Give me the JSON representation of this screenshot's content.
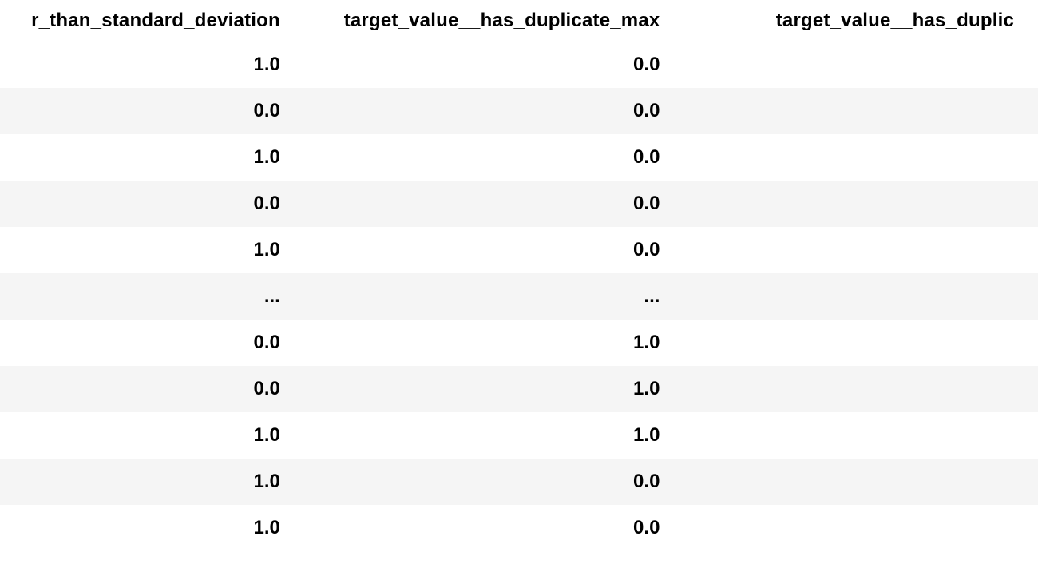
{
  "table": {
    "headers": {
      "h0": "r_than_standard_deviation",
      "h1": "target_value__has_duplicate_max",
      "h2": "target_value__has_duplic"
    },
    "rows": [
      {
        "c0": "1.0",
        "c1": "0.0",
        "c2": ""
      },
      {
        "c0": "0.0",
        "c1": "0.0",
        "c2": ""
      },
      {
        "c0": "1.0",
        "c1": "0.0",
        "c2": ""
      },
      {
        "c0": "0.0",
        "c1": "0.0",
        "c2": ""
      },
      {
        "c0": "1.0",
        "c1": "0.0",
        "c2": ""
      },
      {
        "c0": "...",
        "c1": "...",
        "c2": ""
      },
      {
        "c0": "0.0",
        "c1": "1.0",
        "c2": ""
      },
      {
        "c0": "0.0",
        "c1": "1.0",
        "c2": ""
      },
      {
        "c0": "1.0",
        "c1": "1.0",
        "c2": ""
      },
      {
        "c0": "1.0",
        "c1": "0.0",
        "c2": ""
      },
      {
        "c0": "1.0",
        "c1": "0.0",
        "c2": ""
      }
    ]
  }
}
